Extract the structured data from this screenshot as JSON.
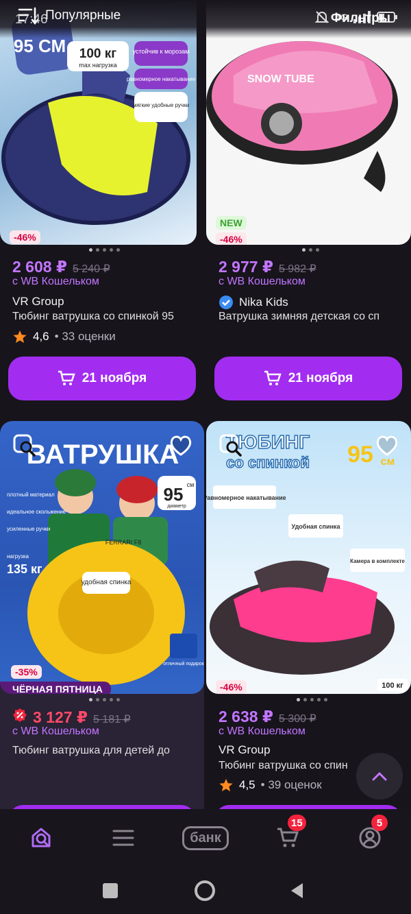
{
  "status": {
    "time": "17:46",
    "network": "4G"
  },
  "sort": {
    "label": "Популярные"
  },
  "filters_label": "Фильтры",
  "products": [
    {
      "badges": [
        "-46%"
      ],
      "price": "2 608 ₽",
      "old_price": "5 240 ₽",
      "wallet": "с WB Кошельком",
      "brand": "VR Group",
      "name": "Тюбинг ватрушка со спинкой 95",
      "rating": "4,6",
      "reviews": "• 33 оценки",
      "delivery": "21 ноября",
      "image_text": [
        "95 СМ",
        "100 кг",
        "max нагрузка",
        "устойчив к морозам",
        "равномерное накатывание",
        "мягкие удобные ручки"
      ]
    },
    {
      "badges": [
        "NEW",
        "-46%"
      ],
      "price": "2 977 ₽",
      "old_price": "5 982 ₽",
      "wallet": "с WB Кошельком",
      "brand": "Nika Kids",
      "name": "Ватрушка зимняя детская со сп",
      "delivery": "21 ноября",
      "image_text": [
        "SNOW TUBE"
      ]
    },
    {
      "badges": [
        "-35%",
        "ЧЁРНАЯ ПЯТНИЦА"
      ],
      "price": "3 127 ₽",
      "old_price": "5 181 ₽",
      "wallet": "с WB Кошельком",
      "name": "Тюбинг ватрушка для детей до",
      "image_text": [
        "ВАТРУШКА",
        "95",
        "см",
        "диаметр",
        "плотный материал",
        "идеальное скольжение",
        "усиленные ручки",
        "нагрузка",
        "135 кг",
        "удобная спинка",
        "FERRARI F8",
        "отличный подарок"
      ]
    },
    {
      "badges": [
        "-46%"
      ],
      "price": "2 638 ₽",
      "old_price": "5 300 ₽",
      "wallet": "с WB Кошельком",
      "brand": "VR Group",
      "name": "Тюбинг ватрушка со спин",
      "rating": "4,5",
      "reviews": "• 39 оценок",
      "image_text": [
        "ТЮБИНГ",
        "со спинкой",
        "95",
        "см",
        "Равномерное накатывание",
        "Удобная спинка",
        "Камера в комплекте",
        "100 кг"
      ]
    }
  ],
  "bottom_nav": {
    "bank_label": "банк",
    "cart_badge": "15",
    "profile_badge": "5"
  },
  "colors": {
    "accent": "#a22df0",
    "price": "#c276ff",
    "badge_red": "#f4233d"
  }
}
